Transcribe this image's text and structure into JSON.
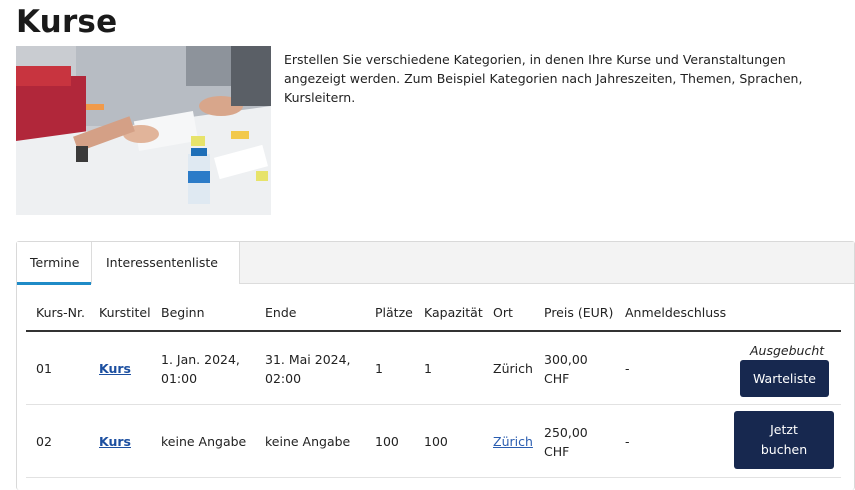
{
  "page": {
    "title": "Kurse",
    "intro": "Erstellen Sie verschiedene Kategorien, in denen Ihre Kurse und Veranstaltungen angezeigt werden. Zum Beispiel Kategorien nach Jahreszeiten, Themen, Sprachen, Kursleitern."
  },
  "tabs": [
    {
      "label": "Termine",
      "active": true
    },
    {
      "label": "Interessentenliste",
      "active": false
    }
  ],
  "table": {
    "headers": [
      "Kurs-Nr.",
      "Kurstitel",
      "Beginn",
      "Ende",
      "Plätze",
      "Kapazität",
      "Ort",
      "Preis (EUR)",
      "Anmeldeschluss"
    ],
    "rows": [
      {
        "nr": "01",
        "title": "Kurs",
        "begin_line1": "1. Jan. 2024,",
        "begin_line2": "01:00",
        "end_line1": "31. Mai 2024,",
        "end_line2": "02:00",
        "places": "1",
        "capacity": "1",
        "location": "Zürich",
        "price_line1": "300,00",
        "price_line2": "CHF",
        "deadline": "-",
        "status": "Ausgebucht",
        "action": "Warteliste"
      },
      {
        "nr": "02",
        "title": "Kurs",
        "begin": "keine Angabe",
        "end": "keine Angabe",
        "places": "100",
        "capacity": "100",
        "location": "Zürich",
        "price_line1": "250,00",
        "price_line2": "CHF",
        "deadline": "-",
        "action_line1": "Jetzt",
        "action_line2": "buchen"
      }
    ]
  },
  "colors": {
    "button": "#17284f",
    "tab_accent": "#1f8bc7",
    "link": "#1c4fa0"
  }
}
